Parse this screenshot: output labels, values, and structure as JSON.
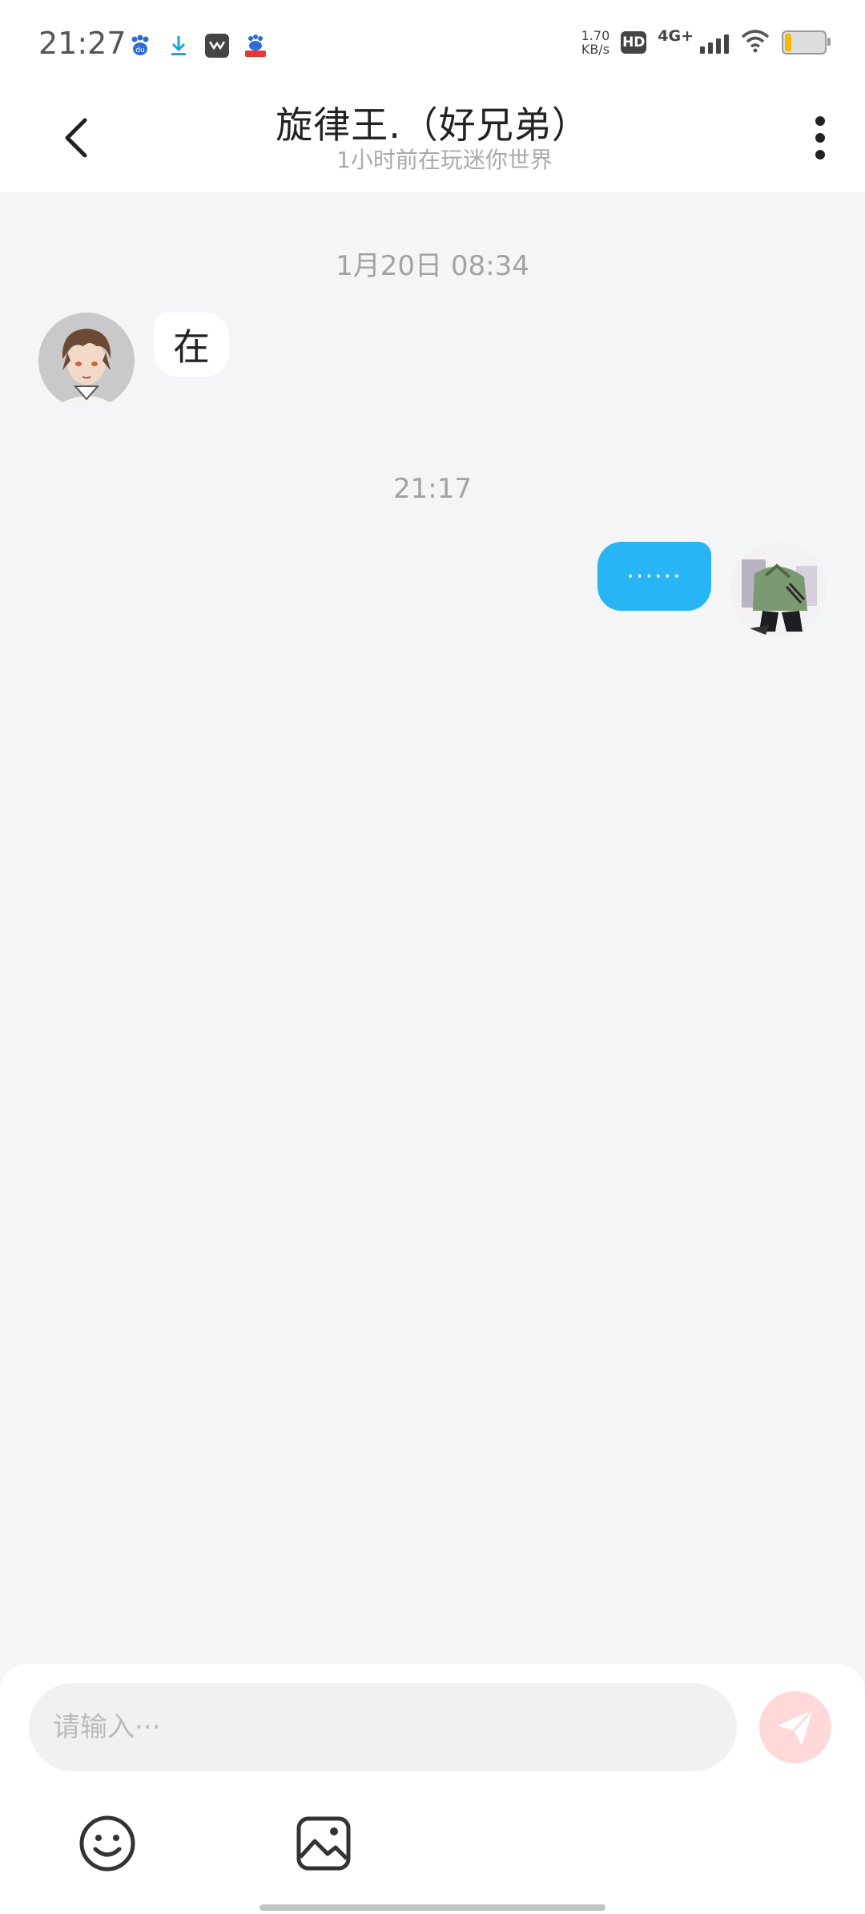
{
  "status_bar": {
    "time": "21:27",
    "net_speed_value": "1.70",
    "net_speed_unit": "KB/s",
    "hd_label": "HD",
    "network_type": "4G+",
    "notification_icons": [
      "baidu-icon",
      "download-icon",
      "mail-app-icon",
      "baidu-app-icon"
    ],
    "battery_level": 0.15,
    "battery_color": "#f5b800"
  },
  "header": {
    "title": "旋律王.（好兄弟）",
    "subtitle": "1小时前在玩迷你世界"
  },
  "messages": [
    {
      "time": "1月20日 08:34",
      "side": "left",
      "text": "在"
    },
    {
      "time": "21:17",
      "side": "right",
      "text": "······"
    }
  ],
  "composer": {
    "placeholder": "请输入···"
  },
  "colors": {
    "sent_bubble": "#28b5f5",
    "send_button": "#ffd9d9",
    "background": "#f4f5f7"
  }
}
